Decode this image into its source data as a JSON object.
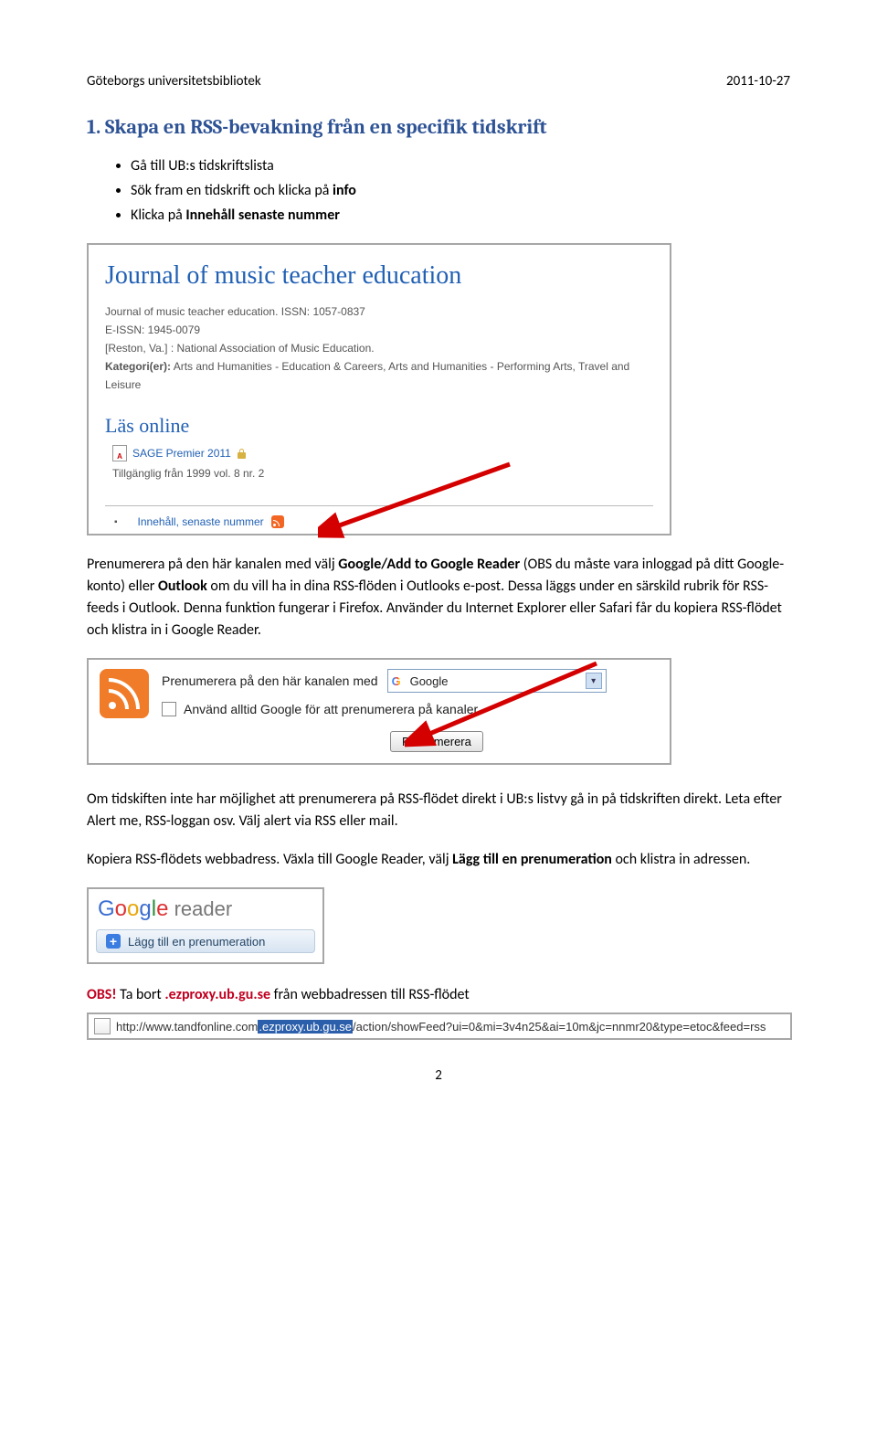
{
  "header": {
    "left": "Göteborgs universitetsbibliotek",
    "right": "2011-10-27"
  },
  "h1": "1. Skapa en RSS-bevakning från en specifik tidskrift",
  "bullets": [
    {
      "pre": "Gå till UB:s tidskriftslista"
    },
    {
      "pre": "Sök fram en tidskrift och klicka på ",
      "bold": "info"
    },
    {
      "pre": "Klicka på ",
      "bold": "Innehåll senaste nummer"
    }
  ],
  "fig1": {
    "title": "Journal of music teacher education",
    "meta_line1": "Journal of music teacher education.  ISSN: 1057-0837",
    "meta_line2": "E-ISSN: 1945-0079",
    "meta_line3": "[Reston, Va.]  :  National Association of Music Education.",
    "meta_line4a": "Kategori(er):",
    "meta_line4b": "  Arts and Humanities - Education & Careers, Arts and Humanities - Performing Arts, Travel and Leisure",
    "las_online": "Läs online",
    "source": "SAGE Premier 2011",
    "availability": "Tillgänglig från 1999 vol. 8 nr. 2",
    "innehall": "Innehåll, senaste nummer"
  },
  "para1a": "Prenumerera på den här kanalen med välj ",
  "para1b": "Google/Add to Google Reader",
  "para1c": " (OBS du måste vara inloggad på ditt Google-konto) eller ",
  "para1d": "Outlook",
  "para1e": " om du vill ha in dina RSS-flöden i Outlooks e-post. Dessa läggs under en särskild rubrik för RSS-feeds i Outlook. Denna funktion fungerar i Firefox. Använder du Internet Explorer eller Safari får du kopiera RSS-flödet och klistra in i Google Reader.",
  "fig2": {
    "line1": "Prenumerera på den här kanalen med",
    "combo_label": "Google",
    "chk_label": "Använd alltid Google för att prenumerera på kanaler.",
    "button": "Prenumerera"
  },
  "para2": "Om tidskiften inte har möjlighet att prenumerera på RSS-flödet direkt i UB:s listvy gå in på tidskriften direkt. Leta efter Alert me, RSS-loggan osv. Välj alert via RSS eller mail.",
  "para3a": "Kopiera RSS-flödets webbadress. Växla till Google Reader, välj ",
  "para3b": "Lägg till en prenumeration",
  "para3c": " och klistra in adressen.",
  "fig3": {
    "reader_word": " reader",
    "add_label": "Lägg till en prenumeration"
  },
  "obs": {
    "label": "OBS!",
    "rest": " Ta bort ",
    "bold": ".ezproxy.ub.gu.se",
    "tail": " från webbadressen till RSS-flödet"
  },
  "fig4": {
    "pre": "http://www.tandfonline.com",
    "sel": ".ezproxy.ub.gu.se",
    "post": "/action/showFeed?ui=0&mi=3v4n25&ai=10m&jc=nnmr20&type=etoc&feed=rss"
  },
  "pagenum": "2"
}
